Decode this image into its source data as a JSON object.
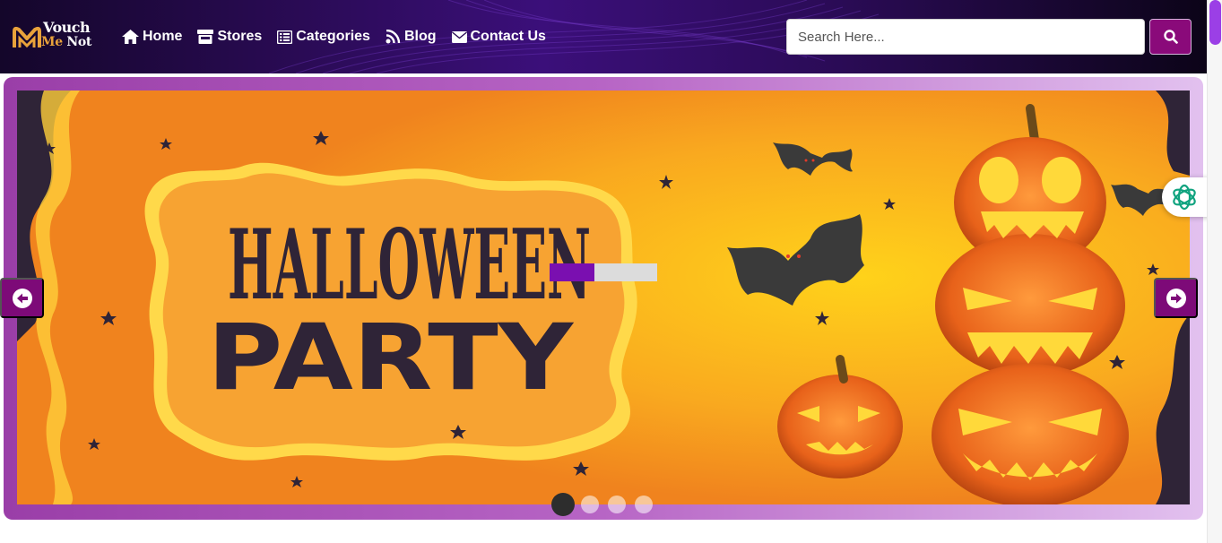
{
  "brand": {
    "name_line1": "Vouch",
    "name_me": "Me",
    "name_not": "Not"
  },
  "nav": {
    "items": [
      {
        "label": "Home",
        "icon": "home-icon"
      },
      {
        "label": "Stores",
        "icon": "store-icon"
      },
      {
        "label": "Categories",
        "icon": "list-icon"
      },
      {
        "label": "Blog",
        "icon": "rss-icon"
      },
      {
        "label": "Contact Us",
        "icon": "envelope-icon"
      }
    ]
  },
  "search": {
    "placeholder": "Search Here...",
    "value": "",
    "button_icon": "search-icon"
  },
  "slider": {
    "headline_1": "HALLOWEEN",
    "headline_2": "PARTY",
    "slide_count": 4,
    "active_slide": 1,
    "progress": 0.42,
    "prev_icon": "arrow-left-icon",
    "next_icon": "arrow-right-icon"
  },
  "widgets": {
    "assistant_icon": "ai-assistant-icon"
  },
  "colors": {
    "brand_purple": "#8a0a7a",
    "nav_bg": "#2a0b55",
    "slide_orange": "#f08a1e",
    "headline": "#2f2437",
    "progress_fill": "#7a0fb0",
    "logo_gold": "#e9a23b"
  }
}
